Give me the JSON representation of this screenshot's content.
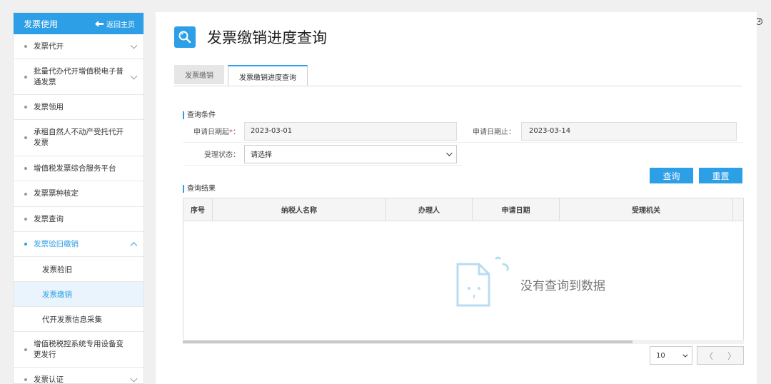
{
  "sidebar": {
    "header_title": "发票使用",
    "home_label": "返回主页",
    "items": [
      {
        "label": "发票代开",
        "chevron": "down"
      },
      {
        "label": "批量代办代开增值税电子普通发票",
        "chevron": "down"
      },
      {
        "label": "发票领用"
      },
      {
        "label": "承租自然人不动产受托代开发票"
      },
      {
        "label": "增值税发票综合服务平台"
      },
      {
        "label": "发票票种核定"
      },
      {
        "label": "发票查询"
      },
      {
        "label": "发票验旧缴销",
        "chevron": "up"
      }
    ],
    "subitems": [
      "发票验旧",
      "发票缴销",
      "代开发票信息采集"
    ],
    "items_after": [
      {
        "label": "增值税税控系统专用设备变更发行"
      },
      {
        "label": "发票认证",
        "chevron": "down"
      }
    ]
  },
  "page": {
    "title": "发票缴销进度查询",
    "tabs": [
      "发票缴销",
      "发票缴销进度查询"
    ],
    "active_tab": 1
  },
  "query": {
    "section_label": "查询条件",
    "start_date_label": "申请日期起",
    "start_date_required": "*",
    "start_date_colon": "：",
    "start_date": "2023-03-01",
    "end_date_label": "申请日期止：",
    "end_date": "2023-03-14",
    "status_label": "受理状态：",
    "status_value": "请选择",
    "search_button": "查询",
    "reset_button": "重置"
  },
  "results": {
    "section_label": "查询结果",
    "columns": [
      "序号",
      "纳税人名称",
      "办理人",
      "申请日期",
      "受理机关"
    ],
    "empty_message": "没有查询到数据"
  },
  "pager": {
    "page_size": "10",
    "prev": "〈",
    "next": "〉"
  },
  "colors": {
    "accent": "#2d9fe6",
    "empty_icon": "#b8dcf3"
  }
}
